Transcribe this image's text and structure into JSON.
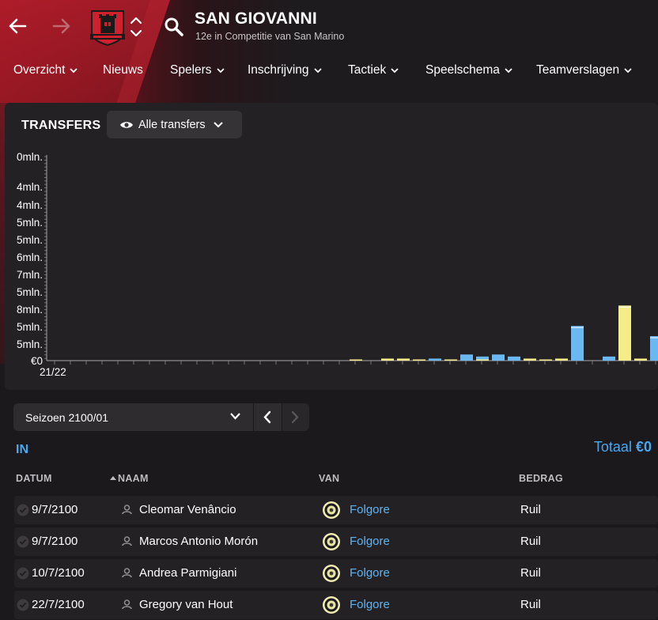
{
  "header": {
    "club_name": "SAN GIOVANNI",
    "subtitle": "12e in Competitie van San Marino"
  },
  "menu": {
    "items": [
      {
        "label": "Overzicht",
        "dropdown": true
      },
      {
        "label": "Nieuws",
        "dropdown": false
      },
      {
        "label": "Spelers",
        "dropdown": true
      },
      {
        "label": "Inschrijving",
        "dropdown": true
      },
      {
        "label": "Tactiek",
        "dropdown": true
      },
      {
        "label": "Speelschema",
        "dropdown": true
      },
      {
        "label": "Teamverslagen",
        "dropdown": true
      }
    ]
  },
  "transfers": {
    "title": "TRANSFERS",
    "filter_label": "Alle transfers"
  },
  "chart_data": {
    "type": "bar",
    "title": "TRANSFERS",
    "y_tick_labels": [
      "0mln.",
      "4mln.",
      "4mln.",
      "5mln.",
      "5mln.",
      "6mln.",
      "7mln.",
      "5mln.",
      "8mln.",
      "5mln.",
      "5mln.",
      "€0"
    ],
    "x_tick_labels": [
      "21/22"
    ],
    "series": [
      {
        "color": "#6ab8f2",
        "values": [
          0,
          0,
          0,
          0,
          0,
          0,
          0,
          0,
          0,
          0,
          0,
          0,
          0,
          0,
          0,
          0,
          0,
          0,
          0,
          0,
          0,
          0,
          0,
          0,
          0.01,
          0.005,
          0.03,
          0.02,
          0.03,
          0.02,
          0.0,
          0.0,
          0.0,
          0.17,
          0.0,
          0.02,
          0.0,
          0.0,
          0.12
        ]
      },
      {
        "color": "#f7ec8a",
        "values": [
          0,
          0,
          0,
          0,
          0,
          0,
          0,
          0,
          0,
          0,
          0,
          0,
          0,
          0,
          0,
          0,
          0,
          0,
          0,
          0.005,
          0,
          0.01,
          0.01,
          0.005,
          0,
          0.005,
          0.0,
          0.005,
          0.0,
          0.0,
          0.01,
          0.005,
          0.01,
          0.0,
          0.0,
          0.0,
          0.27,
          0.01,
          0.0
        ]
      }
    ],
    "grid": false,
    "legend": "none"
  },
  "season": {
    "selected": "Seizoen 2100/01"
  },
  "incoming": {
    "section_label": "IN",
    "total_label": "Totaal",
    "total_value": "€0",
    "columns": {
      "date": "DATUM",
      "name": "NAAM",
      "from": "VAN",
      "amount": "BEDRAG"
    },
    "rows": [
      {
        "date": "9/7/2100",
        "name": "Cleomar Venâncio",
        "from": "Folgore",
        "amount": "Ruil"
      },
      {
        "date": "9/7/2100",
        "name": "Marcos Antonio Morón",
        "from": "Folgore",
        "amount": "Ruil"
      },
      {
        "date": "10/7/2100",
        "name": "Andrea Parmigiani",
        "from": "Folgore",
        "amount": "Ruil"
      },
      {
        "date": "22/7/2100",
        "name": "Gregory van Hout",
        "from": "Folgore",
        "amount": "Ruil"
      }
    ]
  },
  "colors": {
    "accent_blue": "#4aa8f0",
    "club_red": "#9a1622",
    "bar_blue": "#6ab8f2",
    "bar_yellow": "#f7ec8a"
  },
  "icons": {
    "back": "arrow-left-icon",
    "forward": "arrow-right-icon",
    "crest": "club-crest-icon",
    "switch": "chevron-up-down-icon",
    "search": "search-icon",
    "eye": "eye-icon",
    "person": "person-icon",
    "check": "check-circle-icon",
    "club_badge": "club-badge-icon"
  }
}
